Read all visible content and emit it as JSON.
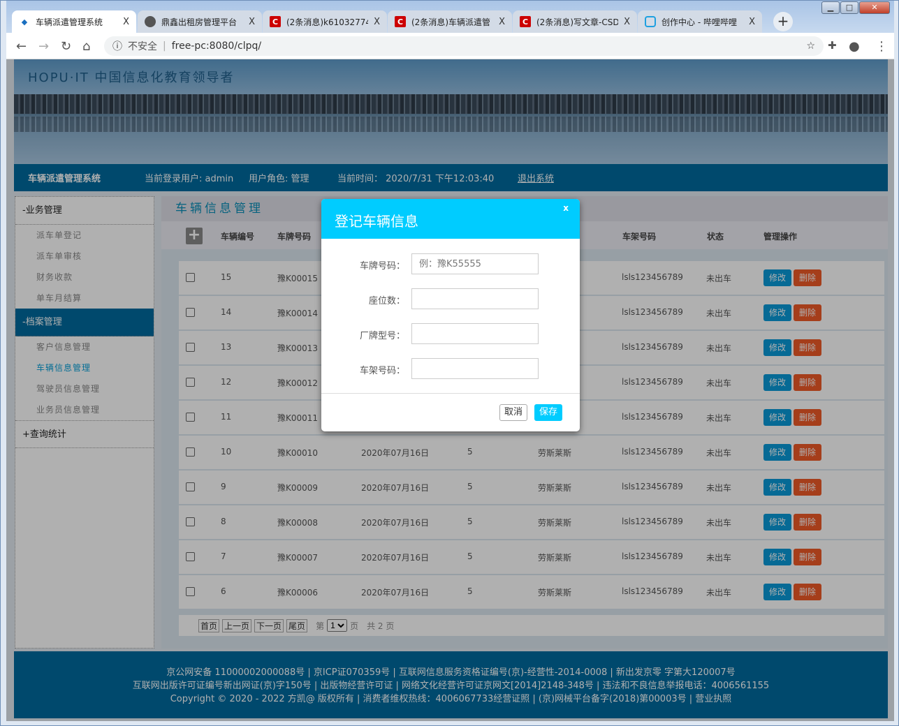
{
  "browser": {
    "tabs": [
      {
        "title": "车辆派遣管理系统",
        "icon": "car-icon",
        "active": true
      },
      {
        "title": "鼎鑫出租房管理平台",
        "icon": "globe-icon"
      },
      {
        "title": "(2条消息)k61032774",
        "icon": "csdn-icon"
      },
      {
        "title": "(2条消息)车辆派遣管",
        "icon": "csdn-icon"
      },
      {
        "title": "(2条消息)写文章-CSD",
        "icon": "csdn-icon"
      },
      {
        "title": "创作中心 - 哔哩哔哩",
        "icon": "bilibili-icon"
      }
    ],
    "close_glyph": "X",
    "security_label": "不安全",
    "url": "free-pc:8080/clpq/"
  },
  "banner": {
    "slogan": "HOPU·IT 中国信息化教育领导者"
  },
  "topbar": {
    "system_name": "车辆派遣管理系统",
    "user": "当前登录用户: admin",
    "role": "用户角色: 管理",
    "time": "当前时间： 2020/7/31 下午12:03:40",
    "logout": "退出系统"
  },
  "sidebar": [
    {
      "label": "-业务管理",
      "items": [
        "派车单登记",
        "派车单审核",
        "财务收款",
        "单车月结算"
      ]
    },
    {
      "label": "-档案管理",
      "active": true,
      "items": [
        "客户信息管理",
        "车辆信息管理",
        "驾驶员信息管理",
        "业务员信息管理"
      ],
      "current": 1
    },
    {
      "label": "+查询统计",
      "items": []
    }
  ],
  "main": {
    "title": "车辆信息管理",
    "headers": {
      "id": "车辆编号",
      "plate": "车牌号码",
      "frame": "车架号码",
      "status": "状态",
      "ops": "管理操作"
    },
    "edit_label": "修改",
    "delete_label": "删除",
    "rows": [
      {
        "id": "15",
        "plate": "豫K00015",
        "date": "",
        "seats": "",
        "brand": "",
        "frame": "lsls123456789",
        "status": "未出车"
      },
      {
        "id": "14",
        "plate": "豫K00014",
        "date": "",
        "seats": "",
        "brand": "",
        "frame": "lsls123456789",
        "status": "未出车"
      },
      {
        "id": "13",
        "plate": "豫K00013",
        "date": "",
        "seats": "",
        "brand": "",
        "frame": "lsls123456789",
        "status": "未出车"
      },
      {
        "id": "12",
        "plate": "豫K00012",
        "date": "",
        "seats": "",
        "brand": "",
        "frame": "lsls123456789",
        "status": "未出车"
      },
      {
        "id": "11",
        "plate": "豫K00011",
        "date": "",
        "seats": "",
        "brand": "",
        "frame": "lsls123456789",
        "status": "未出车"
      },
      {
        "id": "10",
        "plate": "豫K00010",
        "date": "2020年07月16日",
        "seats": "5",
        "brand": "劳斯莱斯",
        "frame": "lsls123456789",
        "status": "未出车"
      },
      {
        "id": "9",
        "plate": "豫K00009",
        "date": "2020年07月16日",
        "seats": "5",
        "brand": "劳斯莱斯",
        "frame": "lsls123456789",
        "status": "未出车"
      },
      {
        "id": "8",
        "plate": "豫K00008",
        "date": "2020年07月16日",
        "seats": "5",
        "brand": "劳斯莱斯",
        "frame": "lsls123456789",
        "status": "未出车"
      },
      {
        "id": "7",
        "plate": "豫K00007",
        "date": "2020年07月16日",
        "seats": "5",
        "brand": "劳斯莱斯",
        "frame": "lsls123456789",
        "status": "未出车"
      },
      {
        "id": "6",
        "plate": "豫K00006",
        "date": "2020年07月16日",
        "seats": "5",
        "brand": "劳斯莱斯",
        "frame": "lsls123456789",
        "status": "未出车"
      }
    ],
    "pager": {
      "first": "首页",
      "prev": "上一页",
      "next": "下一页",
      "last": "尾页",
      "page_prefix": "第",
      "page_value": "1",
      "page_suffix": "页",
      "total": "共 2 页"
    }
  },
  "footer": {
    "lines": [
      "京公网安备 11000002000088号 | 京ICP证070359号 | 互联网信息服务资格证编号(京)-经营性-2014-0008 | 新出发京零 字第大120007号",
      "互联网出版许可证编号新出网证(京)字150号 | 出版物经营许可证 | 网络文化经营许可证京网文[2014]2148-348号 | 违法和不良信息举报电话：4006561155",
      "Copyright © 2020 - 2022 方凯@ 版权所有 | 消费者维权热线：4006067733经营证照 | (京)网械平台备字(2018)第00003号 | 营业执照"
    ]
  },
  "modal": {
    "title": "登记车辆信息",
    "close": "x",
    "fields": [
      {
        "label": "车牌号码：",
        "placeholder": "例：豫K55555",
        "value": ""
      },
      {
        "label": "座位数：",
        "placeholder": "",
        "value": ""
      },
      {
        "label": "厂牌型号：",
        "placeholder": "",
        "value": ""
      },
      {
        "label": "车架号码：",
        "placeholder": "",
        "value": ""
      }
    ],
    "cancel": "取消",
    "save": "保存"
  },
  "colors": {
    "modal_header": "#00ccff",
    "nav": "#006a9e",
    "edit": "#0a9ad8",
    "delete": "#f05a28"
  }
}
